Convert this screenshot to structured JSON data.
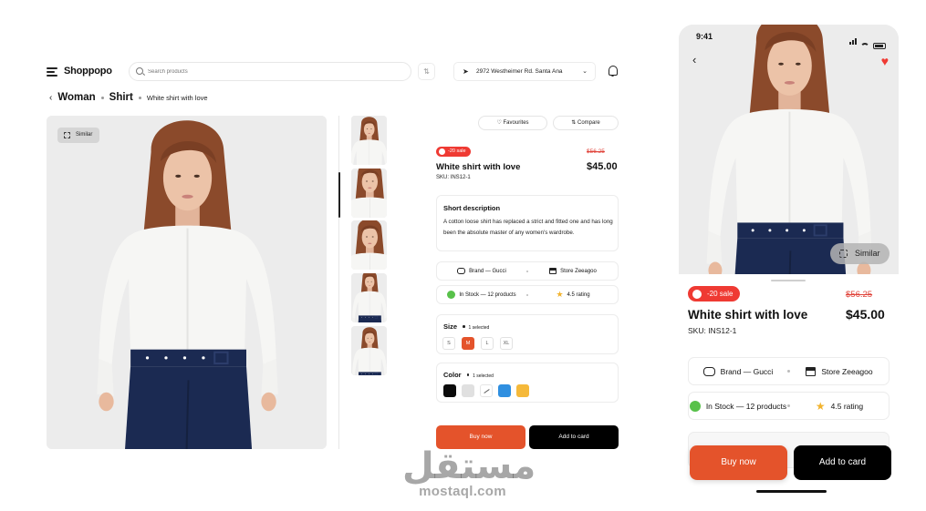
{
  "header": {
    "logo": "Shoppopo",
    "search_placeholder": "Search products",
    "address": "2972 Westheimer Rd. Santa Ana"
  },
  "breadcrumb": {
    "level1": "Woman",
    "level2": "Shirt",
    "current": "White shirt with love"
  },
  "gallery": {
    "similar_label": "Similar",
    "thumbnail_count": 5,
    "selected_thumbnail": 2
  },
  "actions": {
    "favourites_label": "Favourites",
    "compare_label": "Compare"
  },
  "product": {
    "sale_badge": "-20 sale",
    "old_price": "$56.25",
    "title": "White shirt with love",
    "price": "$45.00",
    "sku": "SKU: INS12-1",
    "description_heading": "Short description",
    "description": "A cotton loose shirt has replaced a strict and fitted one and has long been the absolute master of any women's wardrobe.",
    "brand": "Brand — Gucci",
    "store": "Store Zeeagoo",
    "stock": "In Stock — 12 products",
    "rating": "4.5 rating"
  },
  "size": {
    "heading": "Size",
    "selected_text": "1 selected",
    "options": [
      "S",
      "M",
      "L",
      "XL"
    ],
    "selected": "M"
  },
  "color": {
    "heading": "Color",
    "selected_text": "1 selected",
    "swatches": [
      "#0b0b0b",
      "#e0e0e0",
      "#ffffff",
      "#2f8fe0",
      "#f5b93a"
    ]
  },
  "buttons": {
    "buy_now": "Buy now",
    "add_to_cart": "Add to card"
  },
  "mobile": {
    "time": "9:41",
    "similar_label": "Similar",
    "sale_badge": "-20 sale",
    "old_price": "$56.25",
    "title": "White shirt with love",
    "price": "$45.00",
    "sku": "SKU: INS12-1",
    "brand": "Brand — Gucci",
    "store": "Store Zeeagoo",
    "stock": "In Stock — 12 products",
    "rating": "4.5 rating",
    "buy_now": "Buy now",
    "add_to_cart": "Add to card"
  },
  "watermark": {
    "arabic": "مستقل",
    "url": "mostaql.com"
  },
  "colors": {
    "accent": "#e4532b",
    "sale_red": "#ef3a33",
    "stock_green": "#58c14a",
    "star_yellow": "#f2b32e",
    "navy_skirt": "#1b2a52"
  }
}
